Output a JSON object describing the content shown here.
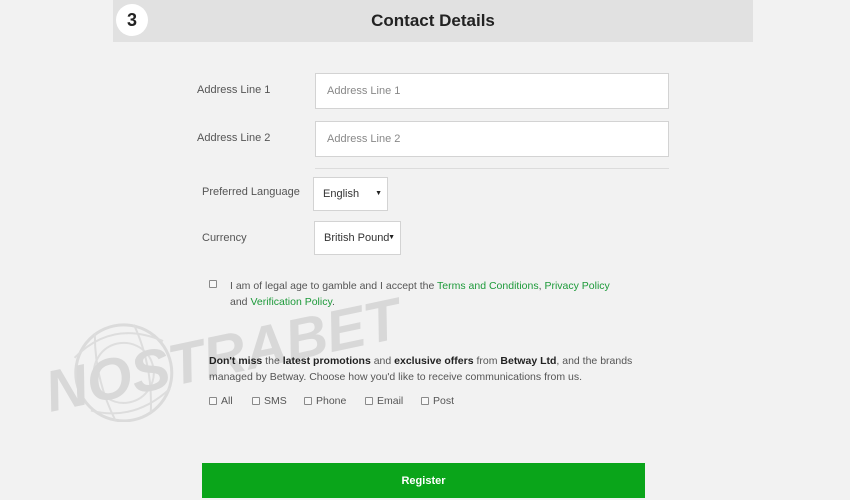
{
  "header": {
    "step_number": "3",
    "title": "Contact Details"
  },
  "address": {
    "line1_label": "Address Line 1",
    "line1_placeholder": "Address Line 1",
    "line2_label": "Address Line 2",
    "line2_placeholder": "Address Line 2"
  },
  "preferences": {
    "language_label": "Preferred Language",
    "language_value": "English",
    "currency_label": "Currency",
    "currency_value": "British Pound"
  },
  "terms": {
    "text_before": "I am of legal age to gamble and I accept the ",
    "terms_link": "Terms and Conditions",
    "comma": ", ",
    "privacy_link": "Privacy Policy",
    "and": " and ",
    "verification_link": "Verification Policy",
    "period": "."
  },
  "promotions": {
    "p1": "Don't miss",
    "p2": " the ",
    "p3": "latest promotions",
    "p4": " and ",
    "p5": "exclusive offers",
    "p6": " from ",
    "p7": "Betway Ltd",
    "p8": ", and the brands managed by Betway. Choose how you'd like to receive communications from us."
  },
  "communications": {
    "options": [
      "All",
      "SMS",
      "Phone",
      "Email",
      "Post"
    ]
  },
  "register_label": "Register",
  "watermark_text": "NOSTRABET",
  "colors": {
    "accent_green": "#0aa51a",
    "link_green": "#1d9a3a"
  }
}
